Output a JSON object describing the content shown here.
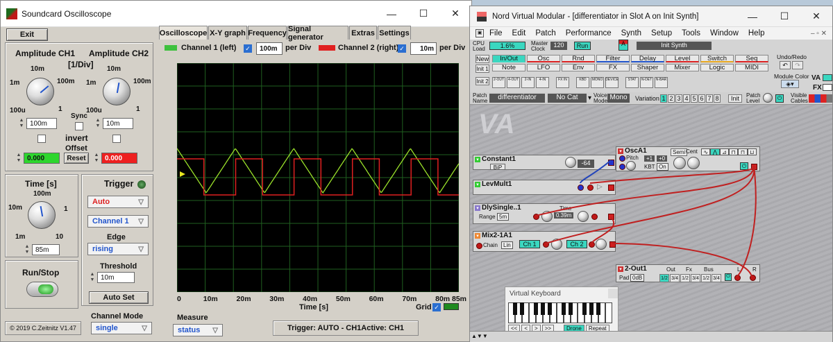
{
  "osc": {
    "title": "Soundcard Oscilloscope",
    "minimize": "—",
    "maximize": "☐",
    "close": "✕",
    "exit_label": "Exit",
    "amp_ch1_title": "Amplitude CH1",
    "amp_ch2_title": "Amplitude CH2",
    "amp_unit": "[1/Div]",
    "knob1_labels": {
      "top": "10m",
      "left": "1m",
      "right": "100m",
      "bl": "100u",
      "br": "1"
    },
    "knob2_labels": {
      "top": "10m",
      "left": "1m",
      "right": "100m",
      "bl": "100u",
      "br": "1"
    },
    "sync_label": "Sync",
    "amp1_value": "100m",
    "amp2_value": "10m",
    "invert_label": "invert",
    "offset_label": "Offset",
    "offset1_value": "0.000",
    "offset2_value": "0.000",
    "reset_label": "Reset",
    "time_title": "Time [s]",
    "time_knob": {
      "top": "100m",
      "left": "10m",
      "right": "1",
      "bl": "1m",
      "br": "10"
    },
    "time_value": "85m",
    "trigger_title": "Trigger",
    "trigger_mode": "Auto",
    "trigger_channel": "Channel 1",
    "edge_label": "Edge",
    "edge_value": "rising",
    "threshold_label": "Threshold",
    "threshold_value": "10m",
    "autoset_label": "Auto Set",
    "runstop_label": "Run/Stop",
    "channel_mode_label": "Channel Mode",
    "channel_mode_value": "single",
    "copyright": "© 2019  C.Zeitnitz V1.47",
    "tabs": [
      "Oscilloscope",
      "X-Y graph",
      "Frequency",
      "Signal generator",
      "Extras",
      "Settings"
    ],
    "ch1_label": "Channel 1 (left)",
    "ch1_div": "100m",
    "ch2_label": "Channel 2 (right)",
    "ch2_div": "10m",
    "per_div": "per Div",
    "x_ticks": [
      "0",
      "10m",
      "20m",
      "30m",
      "40m",
      "50m",
      "60m",
      "70m",
      "80m",
      "85m"
    ],
    "x_axis_label": "Time [s]",
    "grid_label": "Grid",
    "measure_label": "Measure",
    "measure_value": "status",
    "trigger_status": "Trigger: AUTO - CH1Active: CH1",
    "ch1_color": "#3ec13e",
    "ch2_color": "#e02020"
  },
  "nord": {
    "title": "Nord Virtual Modular - [differentiator in Slot A on Init Synth]",
    "menu": [
      "File",
      "Edit",
      "Patch",
      "Performance",
      "Synth",
      "Setup",
      "Tools",
      "Window",
      "Help"
    ],
    "cpu_label": "CPU Load",
    "cpu_value": "1.6%",
    "master_clock_label": "Master Clock",
    "master_clock_value": "120",
    "run_label": "Run",
    "slot_label": "A",
    "synth_name": "Init Synth",
    "new_label": "New",
    "init1_label": "Init 1",
    "init2_label": "Init 2",
    "cat_row1": [
      "In/Out",
      "Osc",
      "Rnd",
      "Filter",
      "Delay",
      "Level",
      "Switch",
      "Seq"
    ],
    "cat_row2": [
      "Note",
      "LFO",
      "Env",
      "FX",
      "Shaper",
      "Mixer",
      "Logic",
      "MIDI"
    ],
    "toolbar_icons": [
      "2-OUT",
      "4-OUT",
      "2-IN",
      "4-IN",
      "FX IN",
      "KBD",
      "MONO",
      "DEVICE",
      "STAT",
      "N-DET",
      "N-BAR"
    ],
    "undo_label": "Undo/Redo",
    "module_color_label": "Module Color",
    "patch_name_label": "Patch Name",
    "patch_name": "differentiator",
    "category": "No Cat",
    "voice_mode_label": "Voice Mode",
    "voice_mode": "Mono",
    "variation_label": "Variation",
    "variations": [
      "1",
      "2",
      "3",
      "4",
      "5",
      "6",
      "7",
      "8"
    ],
    "init_label": "Init",
    "patch_level_label": "Patch Level",
    "visible_cables_label": "Visible Cables",
    "va_label": "VA",
    "fx_label": "FX",
    "modules": {
      "constant": {
        "name": "Constant1",
        "mode": "BiP",
        "value": "-64"
      },
      "levmult": {
        "name": "LevMult1"
      },
      "oscA": {
        "name": "OscA1",
        "pitch": "Pitch",
        "semi": "Semi",
        "cent": "Cent",
        "plus1": "+1",
        "plus0": "+0",
        "kbt": "KBT",
        "on": "On"
      },
      "dly": {
        "name": "DlySingle..1",
        "range_label": "Range",
        "range": "5m",
        "time_label": "Time",
        "time": "0.39m"
      },
      "mix": {
        "name": "Mix2-1A1",
        "chain": "Chain",
        "lin": "Lin",
        "ch1": "Ch 1",
        "ch2": "Ch 2"
      },
      "out": {
        "name": "2-Out1",
        "pad_label": "Pad",
        "pad": "0dB",
        "out": "Out",
        "fx": "Fx",
        "bus": "Bus",
        "l": "L",
        "r": "R",
        "chans": [
          "1/2",
          "3/4",
          "1/2",
          "3/4",
          "1/2",
          "3/4"
        ]
      }
    },
    "vk": {
      "title": "Virtual Keyboard",
      "buttons": [
        "<<",
        "<",
        ">",
        ">>"
      ],
      "drone": "Drone",
      "repeat": "Repeat"
    }
  }
}
